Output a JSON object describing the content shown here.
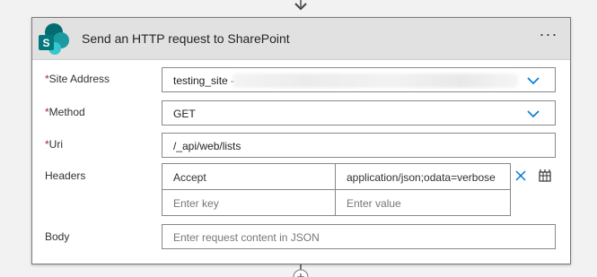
{
  "action": {
    "title": "Send an HTTP request to SharePoint",
    "more_glyph": "···",
    "logo_letter": "S"
  },
  "fields": {
    "site_address": {
      "label": "Site Address",
      "required_mark": "*",
      "value": "testing_site -"
    },
    "method": {
      "label": "Method",
      "required_mark": "*",
      "value": "GET"
    },
    "uri": {
      "label": "Uri",
      "required_mark": "*",
      "value": "/_api/web/lists"
    },
    "headers": {
      "label": "Headers",
      "rows": [
        {
          "key": "Accept",
          "value": "application/json;odata=verbose"
        }
      ],
      "key_placeholder": "Enter key",
      "value_placeholder": "Enter value"
    },
    "body": {
      "label": "Body",
      "placeholder": "Enter request content in JSON"
    }
  },
  "colors": {
    "accent": "#0078d4",
    "required": "#a4262c",
    "header_bg": "#e1e1e1"
  },
  "icons": [
    "chevron-down-icon",
    "close-icon",
    "table-toggle-icon",
    "sharepoint-logo",
    "flow-arrow-icon"
  ]
}
